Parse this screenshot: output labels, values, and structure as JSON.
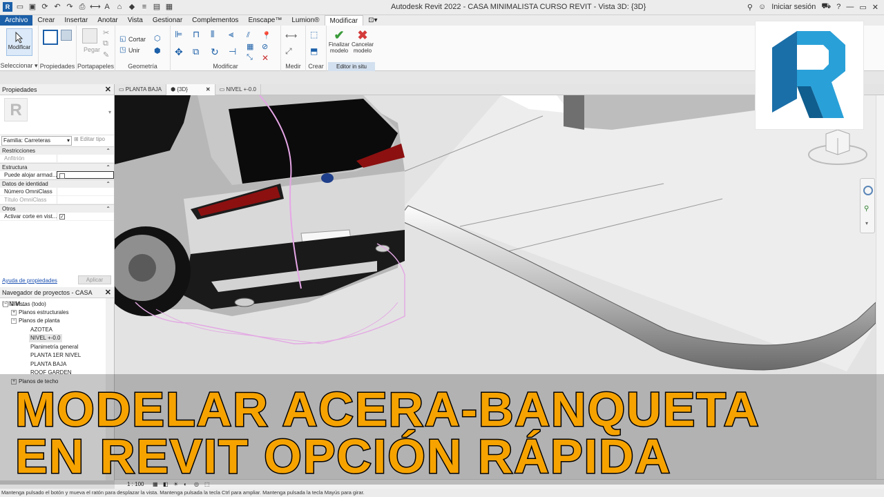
{
  "window": {
    "title": "Autodesk Revit 2022 - CASA MINIMALISTA CURSO REVIT - Vista 3D: {3D}",
    "signin": "Iniciar sesión"
  },
  "ribbon": {
    "tabs": [
      "Archivo",
      "Crear",
      "Insertar",
      "Anotar",
      "Vista",
      "Gestionar",
      "Complementos",
      "Enscape™",
      "Lumion®",
      "Modificar"
    ],
    "active_tab": "Modificar",
    "modify_label": "Modificar",
    "paste_label": "Pegar",
    "cut_label": "Cortar",
    "join_label": "Unir",
    "finish_label_1": "Finalizar",
    "finish_label_2": "modelo",
    "cancel_label_1": "Cancelar",
    "cancel_label_2": "modelo",
    "groups": {
      "select": "Seleccionar",
      "properties": "Propiedades",
      "clipboard": "Portapapeles",
      "geometry": "Geometría",
      "modify": "Modificar",
      "measure": "Medir",
      "create": "Crear",
      "in_place": "Editor in situ"
    }
  },
  "properties": {
    "header": "Propiedades",
    "family": "Familia: Carreteras",
    "edit_type": "Editar tipo",
    "sections": {
      "constraints": "Restricciones",
      "structure": "Estructura",
      "identity": "Datos de identidad",
      "other": "Otros"
    },
    "rows": {
      "host": "Anfitrión",
      "can_host": "Puede alojar armad...",
      "omniclass_number": "Número OmniClass",
      "omniclass_title": "Título OmniClass",
      "cut_enabled": "Activar corte en vist..."
    },
    "help": "Ayuda de propiedades",
    "apply": "Aplicar"
  },
  "browser": {
    "header": "Navegador de proyectos - CASA MINIM...",
    "items": {
      "views": "Vistas (todo)",
      "structural": "Planos estructurales",
      "floor_plans": "Planos de planta",
      "azotea": "AZOTEA",
      "nivel": "NIVEL +-0.0",
      "planimetria": "Planimetría general",
      "planta1": "PLANTA 1ER NIVEL",
      "plantabaja": "PLANTA BAJA",
      "roofgarden": "ROOF GARDEN",
      "ceiling": "Planos de techo"
    }
  },
  "view_tabs": [
    "PLANTA BAJA",
    "{3D}",
    "NIVEL +-0.0"
  ],
  "view_control": {
    "scale": "1 : 100"
  },
  "status_bar": "Mantenga pulsado el botón y mueva el ratón para desplazar la vista. Mantenga pulsada la tecla Ctrl para ampliar. Mantenga pulsada la tecla Mayús para girar.",
  "overlay": {
    "line1": "MODELAR ACERA-BANQUETA",
    "line2": "EN REVIT OPCIÓN RÁPIDA"
  },
  "colors": {
    "accent": "#1b5fa8",
    "headline": "#f6a300",
    "logo_blue": "#1f8ac9"
  }
}
